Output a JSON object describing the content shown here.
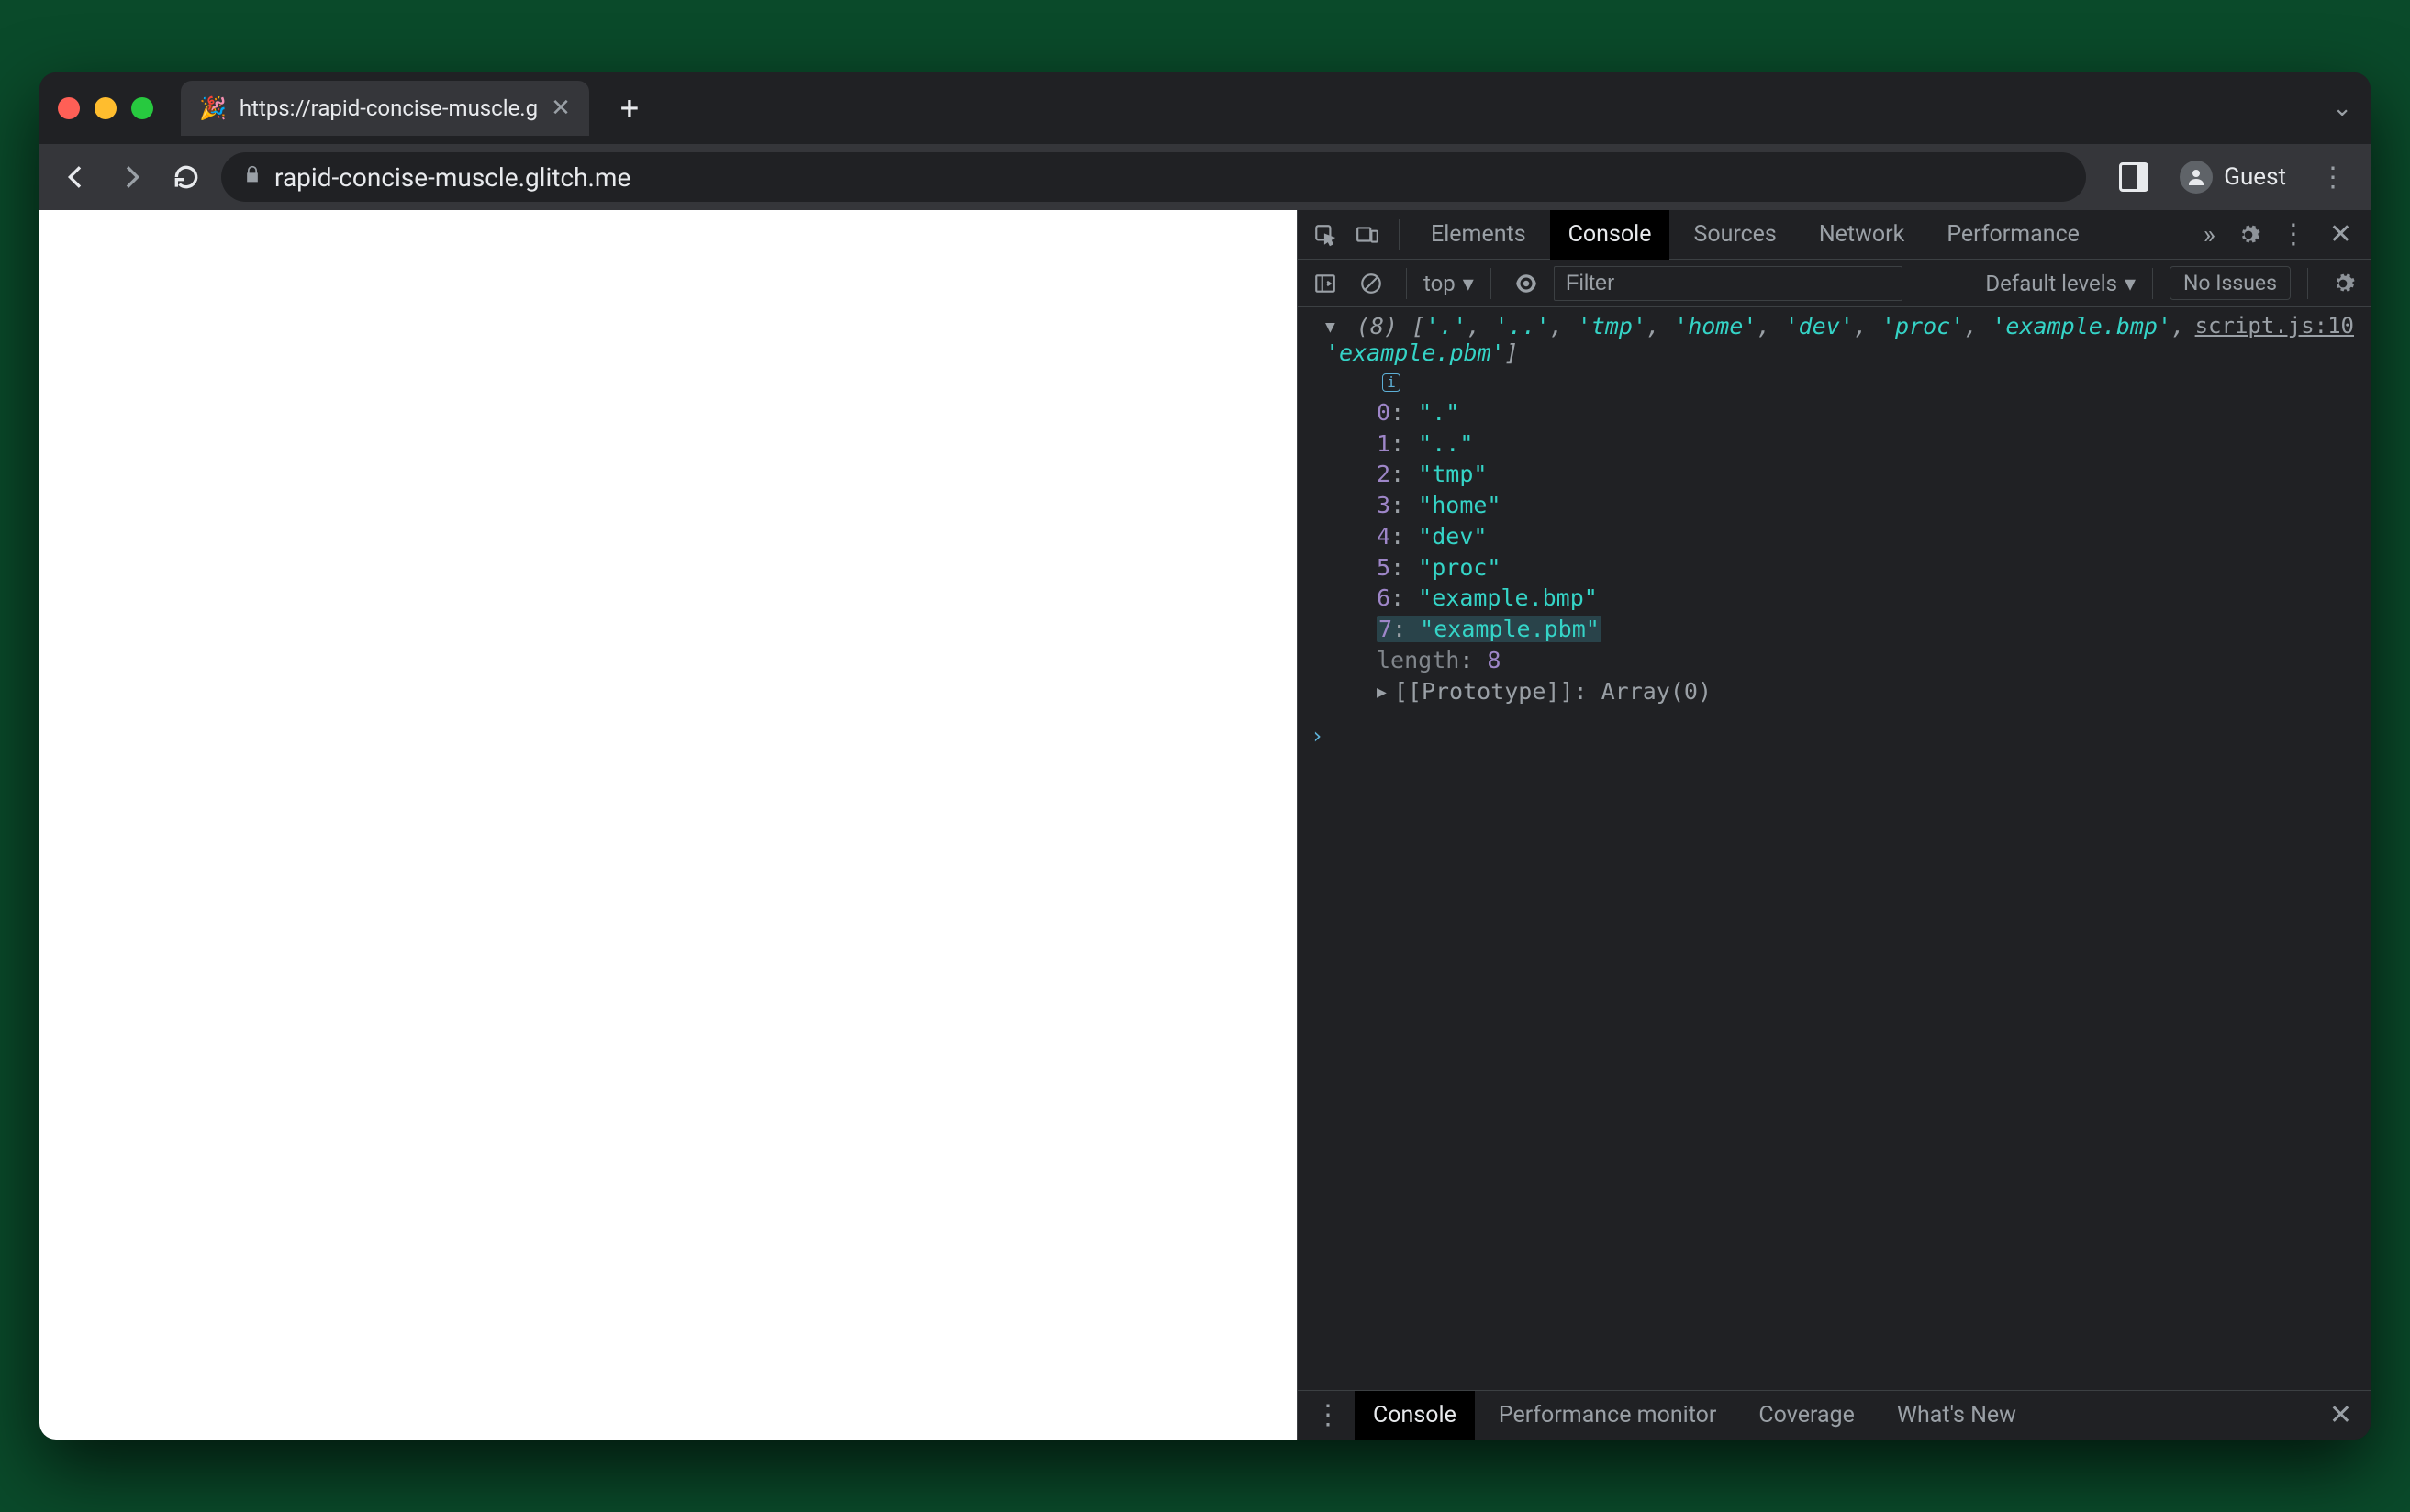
{
  "window": {
    "tab_title": "https://rapid-concise-muscle.g",
    "favicon": "🎉",
    "url": "rapid-concise-muscle.glitch.me",
    "guest_label": "Guest"
  },
  "devtools": {
    "tabs": [
      "Elements",
      "Console",
      "Sources",
      "Network",
      "Performance"
    ],
    "active_tab": "Console",
    "more_tabs_glyph": "»",
    "toolbar": {
      "context": "top",
      "filter_placeholder": "Filter",
      "levels": "Default levels",
      "issues": "No Issues"
    },
    "source_link": "script.js:10",
    "log": {
      "count": "(8)",
      "summary": [
        "'.'",
        "'..'",
        "'tmp'",
        "'home'",
        "'dev'",
        "'proc'",
        "'example.bmp'",
        "'example.pbm'"
      ],
      "items": [
        {
          "k": "0",
          "v": "\".\""
        },
        {
          "k": "1",
          "v": "\"..\""
        },
        {
          "k": "2",
          "v": "\"tmp\""
        },
        {
          "k": "3",
          "v": "\"home\""
        },
        {
          "k": "4",
          "v": "\"dev\""
        },
        {
          "k": "5",
          "v": "\"proc\""
        },
        {
          "k": "6",
          "v": "\"example.bmp\""
        },
        {
          "k": "7",
          "v": "\"example.pbm\""
        }
      ],
      "length_key": "length",
      "length_val": "8",
      "proto_label": "[[Prototype]]",
      "proto_val": "Array(0)"
    },
    "drawer": {
      "tabs": [
        "Console",
        "Performance monitor",
        "Coverage",
        "What's New"
      ],
      "active": "Console"
    }
  }
}
